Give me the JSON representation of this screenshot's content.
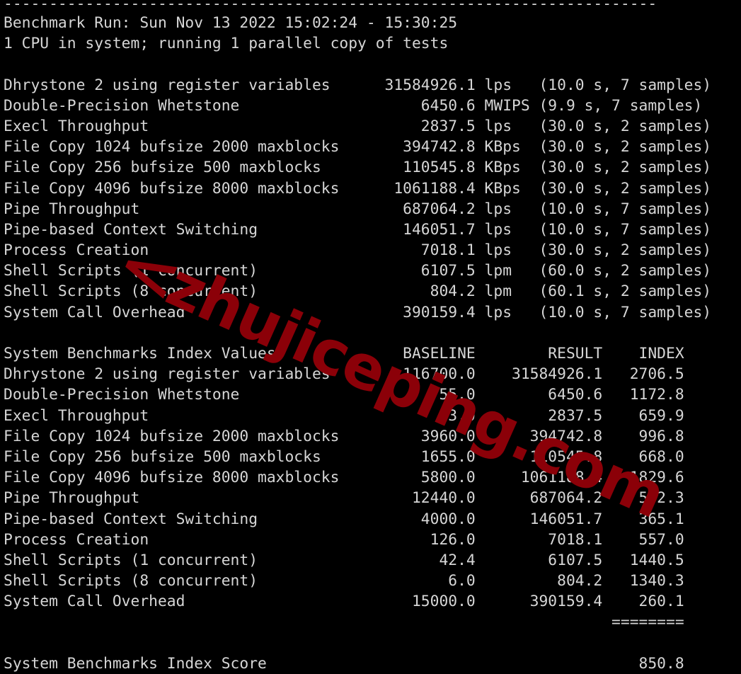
{
  "terminal": {
    "background_color": "#000000",
    "text_color": "#d6d6d6",
    "separator_top": "------------------------------------------------------------------------",
    "header": {
      "benchmark_run_line": "Benchmark Run: Sun Nov 13 2022 15:02:24 - 15:30:25",
      "cpu_line": "1 CPU in system; running 1 parallel copy of tests"
    },
    "raw_results": {
      "rows": [
        {
          "name": "Dhrystone 2 using register variables",
          "value": "31584926.1",
          "unit": "lps",
          "detail": "(10.0 s, 7 samples)"
        },
        {
          "name": "Double-Precision Whetstone",
          "value": "6450.6",
          "unit": "MWIPS",
          "detail": "(9.9 s, 7 samples)"
        },
        {
          "name": "Execl Throughput",
          "value": "2837.5",
          "unit": "lps",
          "detail": "(30.0 s, 2 samples)"
        },
        {
          "name": "File Copy 1024 bufsize 2000 maxblocks",
          "value": "394742.8",
          "unit": "KBps",
          "detail": "(30.0 s, 2 samples)"
        },
        {
          "name": "File Copy 256 bufsize 500 maxblocks",
          "value": "110545.8",
          "unit": "KBps",
          "detail": "(30.0 s, 2 samples)"
        },
        {
          "name": "File Copy 4096 bufsize 8000 maxblocks",
          "value": "1061188.4",
          "unit": "KBps",
          "detail": "(30.0 s, 2 samples)"
        },
        {
          "name": "Pipe Throughput",
          "value": "687064.2",
          "unit": "lps",
          "detail": "(10.0 s, 7 samples)"
        },
        {
          "name": "Pipe-based Context Switching",
          "value": "146051.7",
          "unit": "lps",
          "detail": "(10.0 s, 7 samples)"
        },
        {
          "name": "Process Creation",
          "value": "7018.1",
          "unit": "lps",
          "detail": "(30.0 s, 2 samples)"
        },
        {
          "name": "Shell Scripts (1 concurrent)",
          "value": "6107.5",
          "unit": "lpm",
          "detail": "(60.0 s, 2 samples)"
        },
        {
          "name": "Shell Scripts (8 concurrent)",
          "value": "804.2",
          "unit": "lpm",
          "detail": "(60.1 s, 2 samples)"
        },
        {
          "name": "System Call Overhead",
          "value": "390159.4",
          "unit": "lps",
          "detail": "(10.0 s, 7 samples)"
        }
      ]
    },
    "index_table": {
      "title": "System Benchmarks Index Values",
      "columns": [
        "BASELINE",
        "RESULT",
        "INDEX"
      ],
      "rows": [
        {
          "name": "Dhrystone 2 using register variables",
          "baseline": "116700.0",
          "result": "31584926.1",
          "index": "2706.5"
        },
        {
          "name": "Double-Precision Whetstone",
          "baseline": "55.0",
          "result": "6450.6",
          "index": "1172.8"
        },
        {
          "name": "Execl Throughput",
          "baseline": "43.0",
          "result": "2837.5",
          "index": "659.9"
        },
        {
          "name": "File Copy 1024 bufsize 2000 maxblocks",
          "baseline": "3960.0",
          "result": "394742.8",
          "index": "996.8"
        },
        {
          "name": "File Copy 256 bufsize 500 maxblocks",
          "baseline": "1655.0",
          "result": "110545.8",
          "index": "668.0"
        },
        {
          "name": "File Copy 4096 bufsize 8000 maxblocks",
          "baseline": "5800.0",
          "result": "1061188.4",
          "index": "1829.6"
        },
        {
          "name": "Pipe Throughput",
          "baseline": "12440.0",
          "result": "687064.2",
          "index": "552.3"
        },
        {
          "name": "Pipe-based Context Switching",
          "baseline": "4000.0",
          "result": "146051.7",
          "index": "365.1"
        },
        {
          "name": "Process Creation",
          "baseline": "126.0",
          "result": "7018.1",
          "index": "557.0"
        },
        {
          "name": "Shell Scripts (1 concurrent)",
          "baseline": "42.4",
          "result": "6107.5",
          "index": "1440.5"
        },
        {
          "name": "Shell Scripts (8 concurrent)",
          "baseline": "6.0",
          "result": "804.2",
          "index": "1340.3"
        },
        {
          "name": "System Call Overhead",
          "baseline": "15000.0",
          "result": "390159.4",
          "index": "260.1"
        }
      ],
      "score_rule": "========",
      "score_label": "System Benchmarks Index Score",
      "score_value": "850.8"
    }
  },
  "watermark": {
    "text": "zhujiceping.com",
    "color": "#8b0008"
  }
}
